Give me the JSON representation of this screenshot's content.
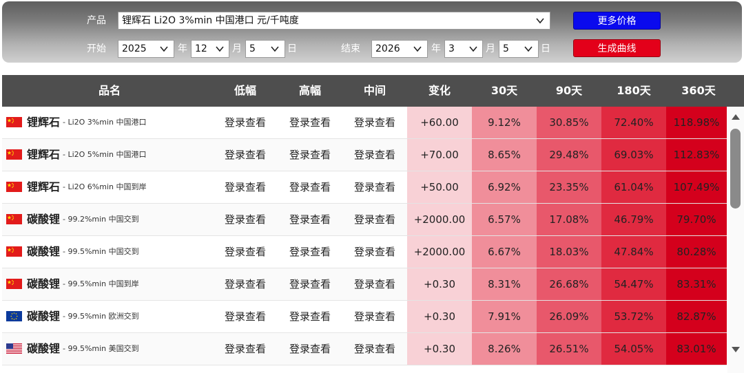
{
  "controls": {
    "product_label": "产品",
    "product_value": "锂辉石 Li2O 3%min 中国港口 元/千吨度",
    "start_label": "开始",
    "end_label": "结束",
    "year_unit": "年",
    "month_unit": "月",
    "day_unit": "日",
    "start_year": "2025",
    "start_month": "12",
    "start_day": "5",
    "end_year": "2026",
    "end_month": "3",
    "end_day": "5",
    "more_prices_label": "更多价格",
    "generate_curve_label": "生成曲线"
  },
  "colors": {
    "more_prices_button": "#0a0aee",
    "generate_curve_button": "#e3001a",
    "header_bg": "#4e4e4e"
  },
  "table": {
    "headers": [
      "品名",
      "低幅",
      "高幅",
      "中间",
      "变化",
      "30天",
      "90天",
      "180天",
      "360天"
    ],
    "rows": [
      {
        "flag": "cn-flag",
        "name": "锂辉石",
        "spec": "- Li2O 3%min 中国港口",
        "low": "登录查看",
        "high": "登录查看",
        "mid": "登录查看",
        "change": "+60.00",
        "d30": "9.12%",
        "d90": "30.85%",
        "d180": "72.40%",
        "d360": "118.98%"
      },
      {
        "flag": "cn-flag",
        "name": "锂辉石",
        "spec": "- Li2O 5%min 中国港口",
        "low": "登录查看",
        "high": "登录查看",
        "mid": "登录查看",
        "change": "+70.00",
        "d30": "8.65%",
        "d90": "29.48%",
        "d180": "69.03%",
        "d360": "112.83%"
      },
      {
        "flag": "cn-flag",
        "name": "锂辉石",
        "spec": "- Li2O 6%min 中国到岸",
        "low": "登录查看",
        "high": "登录查看",
        "mid": "登录查看",
        "change": "+50.00",
        "d30": "6.92%",
        "d90": "23.35%",
        "d180": "61.04%",
        "d360": "107.49%"
      },
      {
        "flag": "cn-flag",
        "name": "碳酸锂",
        "spec": "- 99.2%min 中国交到",
        "low": "登录查看",
        "high": "登录查看",
        "mid": "登录查看",
        "change": "+2000.00",
        "d30": "6.57%",
        "d90": "17.08%",
        "d180": "46.79%",
        "d360": "79.70%"
      },
      {
        "flag": "cn-flag",
        "name": "碳酸锂",
        "spec": "- 99.5%min 中国交到",
        "low": "登录查看",
        "high": "登录查看",
        "mid": "登录查看",
        "change": "+2000.00",
        "d30": "6.67%",
        "d90": "18.03%",
        "d180": "47.84%",
        "d360": "80.28%"
      },
      {
        "flag": "cn-flag",
        "name": "碳酸锂",
        "spec": "- 99.5%min 中国到岸",
        "low": "登录查看",
        "high": "登录查看",
        "mid": "登录查看",
        "change": "+0.30",
        "d30": "8.31%",
        "d90": "26.68%",
        "d180": "54.47%",
        "d360": "83.31%"
      },
      {
        "flag": "eu-flag",
        "name": "碳酸锂",
        "spec": "- 99.5%min 欧洲交到",
        "low": "登录查看",
        "high": "登录查看",
        "mid": "登录查看",
        "change": "+0.30",
        "d30": "7.91%",
        "d90": "26.09%",
        "d180": "53.72%",
        "d360": "82.87%"
      },
      {
        "flag": "us-flag",
        "name": "碳酸锂",
        "spec": "- 99.5%min 美国交到",
        "low": "登录查看",
        "high": "登录查看",
        "mid": "登录查看",
        "change": "+0.30",
        "d30": "8.26%",
        "d90": "26.51%",
        "d180": "54.05%",
        "d360": "83.01%"
      }
    ]
  }
}
